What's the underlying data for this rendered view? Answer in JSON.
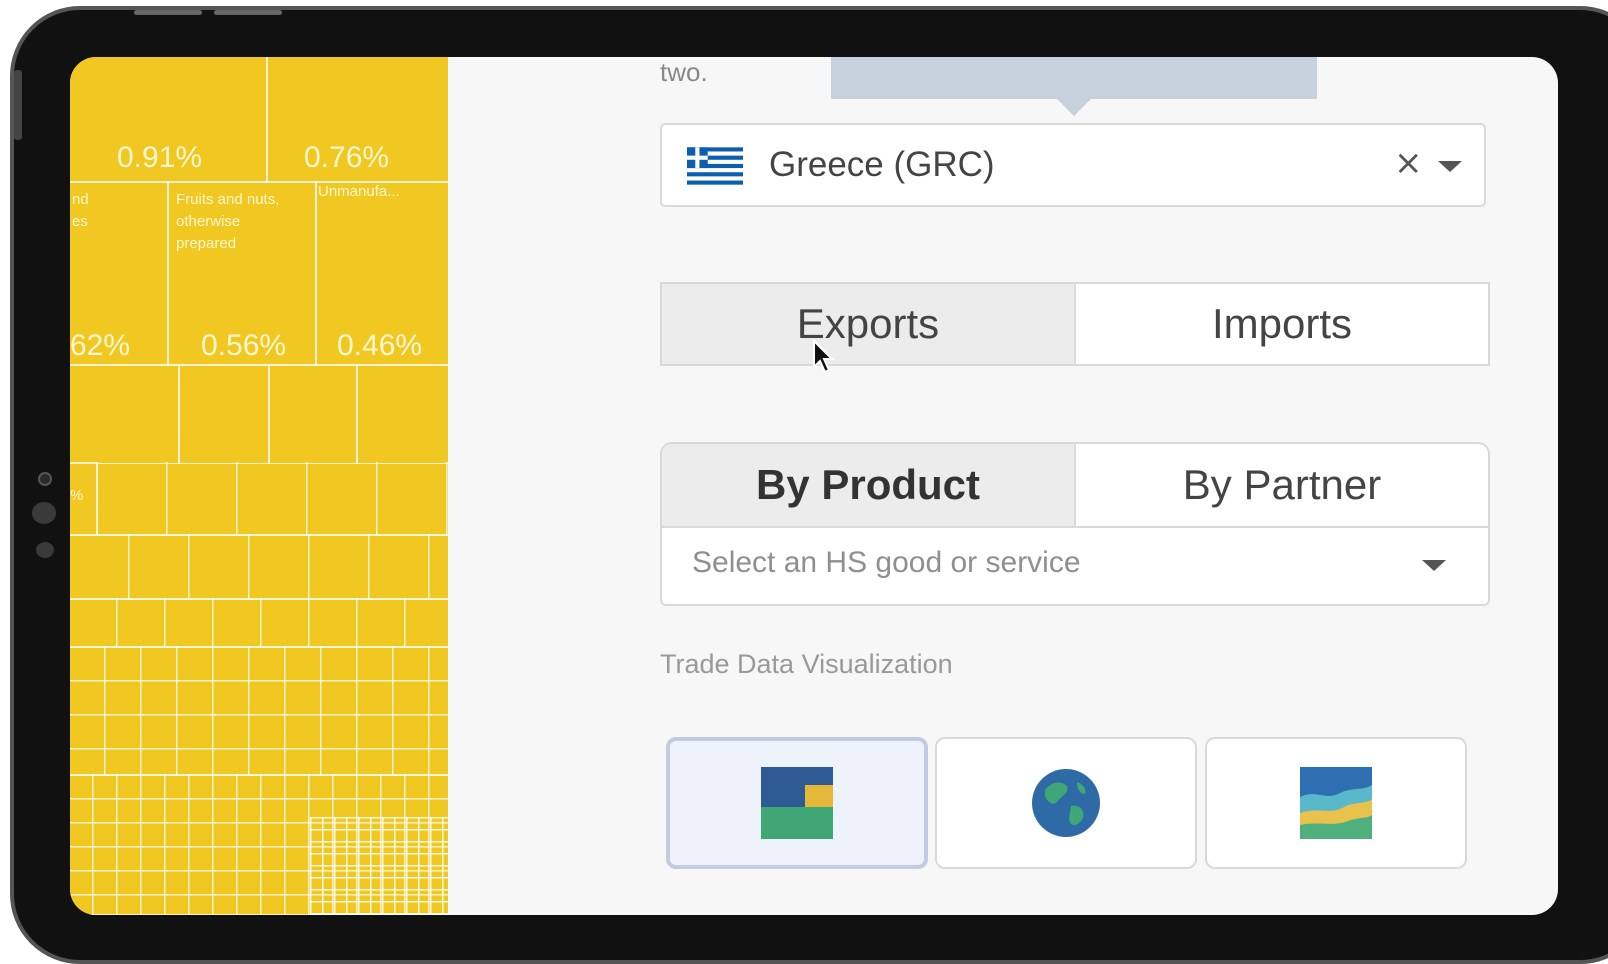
{
  "treemap": {
    "percentages": [
      "0.91%",
      "0.76%",
      "62%",
      "0.56%",
      "0.46%",
      "%"
    ],
    "labels": {
      "left_partial": [
        "nd",
        "es"
      ],
      "fruits": [
        "Fruits and nuts,",
        "otherwise",
        "prepared"
      ],
      "unmanufactured": "Unmanufa..."
    },
    "color": "#f1c721"
  },
  "panel": {
    "intro_text": "two.",
    "country_select": {
      "value": "Greece (GRC)",
      "flag_icon": "greece-flag-icon",
      "clear_label": "×"
    },
    "trade_toggle": {
      "exports": "Exports",
      "imports": "Imports",
      "active": "exports"
    },
    "view_toggle": {
      "by_product": "By Product",
      "by_partner": "By Partner",
      "active": "by_product"
    },
    "hs_select": {
      "placeholder": "Select an HS good or service"
    },
    "visualization": {
      "label": "Trade Data Visualization",
      "options": [
        {
          "icon": "treemap-icon",
          "active": true
        },
        {
          "icon": "globe-icon",
          "active": false
        },
        {
          "icon": "stacked-area-chart-icon",
          "active": false
        }
      ]
    }
  }
}
